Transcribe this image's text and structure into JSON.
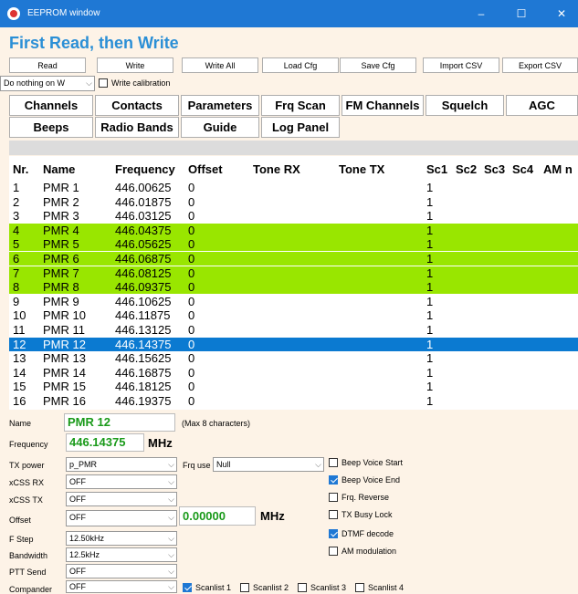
{
  "window": {
    "title": "EEPROM window",
    "minimize": "–",
    "maximize": "☐",
    "close": "✕"
  },
  "headline": "First Read, then Write",
  "toolbar": [
    "Read",
    "Write",
    "Write All",
    "Load Cfg",
    "Save Cfg",
    "Import CSV",
    "Export CSV"
  ],
  "mode_select": {
    "value": "Do nothing on W"
  },
  "write_calibration": {
    "label": "Write calibration",
    "checked": false
  },
  "nav_row1": [
    "Channels",
    "Contacts",
    "Parameters",
    "Frq Scan",
    "FM Channels",
    "Squelch",
    "AGC"
  ],
  "nav_row2": [
    "Beeps",
    "Radio Bands",
    "Guide",
    "Log Panel"
  ],
  "table": {
    "headers": [
      "Nr.",
      "Name",
      "Frequency",
      "Offset",
      "Tone RX",
      "Tone TX",
      "Sc1",
      "Sc2",
      "Sc3",
      "Sc4",
      "AM n"
    ],
    "rows": [
      {
        "nr": "1",
        "name": "PMR 1",
        "freq": "446.00625",
        "offset": "0",
        "sc1": "1",
        "style": "normal"
      },
      {
        "nr": "2",
        "name": "PMR 2",
        "freq": "446.01875",
        "offset": "0",
        "sc1": "1",
        "style": "normal"
      },
      {
        "nr": "3",
        "name": "PMR 3",
        "freq": "446.03125",
        "offset": "0",
        "sc1": "1",
        "style": "normal"
      },
      {
        "nr": "4",
        "name": "PMR 4",
        "freq": "446.04375",
        "offset": "0",
        "sc1": "1",
        "style": "green"
      },
      {
        "nr": "5",
        "name": "PMR 5",
        "freq": "446.05625",
        "offset": "0",
        "sc1": "1",
        "style": "green"
      },
      {
        "nr": "6",
        "name": "PMR 6",
        "freq": "446.06875",
        "offset": "0",
        "sc1": "1",
        "style": "green"
      },
      {
        "nr": "7",
        "name": "PMR 7",
        "freq": "446.08125",
        "offset": "0",
        "sc1": "1",
        "style": "green"
      },
      {
        "nr": "8",
        "name": "PMR 8",
        "freq": "446.09375",
        "offset": "0",
        "sc1": "1",
        "style": "green"
      },
      {
        "nr": "9",
        "name": "PMR 9",
        "freq": "446.10625",
        "offset": "0",
        "sc1": "1",
        "style": "normal"
      },
      {
        "nr": "10",
        "name": "PMR 10",
        "freq": "446.11875",
        "offset": "0",
        "sc1": "1",
        "style": "normal"
      },
      {
        "nr": "11",
        "name": "PMR 11",
        "freq": "446.13125",
        "offset": "0",
        "sc1": "1",
        "style": "normal"
      },
      {
        "nr": "12",
        "name": "PMR 12",
        "freq": "446.14375",
        "offset": "0",
        "sc1": "1",
        "style": "selected"
      },
      {
        "nr": "13",
        "name": "PMR 13",
        "freq": "446.15625",
        "offset": "0",
        "sc1": "1",
        "style": "normal"
      },
      {
        "nr": "14",
        "name": "PMR 14",
        "freq": "446.16875",
        "offset": "0",
        "sc1": "1",
        "style": "normal"
      },
      {
        "nr": "15",
        "name": "PMR 15",
        "freq": "446.18125",
        "offset": "0",
        "sc1": "1",
        "style": "normal"
      },
      {
        "nr": "16",
        "name": "PMR 16",
        "freq": "446.19375",
        "offset": "0",
        "sc1": "1",
        "style": "normal"
      }
    ]
  },
  "editor": {
    "name": {
      "label": "Name",
      "value": "PMR 12",
      "hint": "(Max 8 characters)"
    },
    "frequency": {
      "label": "Frequency",
      "value": "446.14375",
      "unit": "MHz"
    },
    "tx_power": {
      "label": "TX power",
      "value": "p_PMR"
    },
    "frq_use": {
      "label": "Frq use",
      "value": "Null"
    },
    "xcss_rx": {
      "label": "xCSS RX",
      "value": "OFF"
    },
    "xcss_tx": {
      "label": "xCSS TX",
      "value": "OFF"
    },
    "offset": {
      "label": "Offset",
      "value": "OFF",
      "amount": "0.00000",
      "unit": "MHz"
    },
    "f_step": {
      "label": "F Step",
      "value": "12.50kHz"
    },
    "bandwidth": {
      "label": "Bandwidth",
      "value": "12.5kHz"
    },
    "ptt_send": {
      "label": "PTT Send",
      "value": "OFF"
    },
    "compander": {
      "label": "Compander",
      "value": "OFF"
    },
    "options": [
      {
        "label": "Beep Voice Start",
        "checked": false
      },
      {
        "label": "Beep Voice End",
        "checked": true
      },
      {
        "label": "Frq. Reverse",
        "checked": false
      },
      {
        "label": "TX Busy Lock",
        "checked": false
      },
      {
        "label": "DTMF decode",
        "checked": true
      },
      {
        "label": "AM modulation",
        "checked": false
      }
    ],
    "scanlists": [
      {
        "label": "Scanlist 1",
        "checked": true
      },
      {
        "label": "Scanlist 2",
        "checked": false
      },
      {
        "label": "Scanlist 3",
        "checked": false
      },
      {
        "label": "Scanlist 4",
        "checked": false
      }
    ]
  }
}
